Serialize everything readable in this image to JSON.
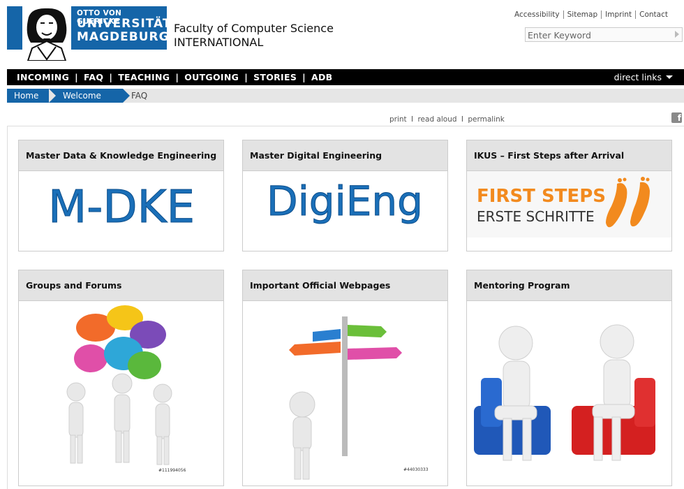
{
  "logo": {
    "line1": "OTTO VON GUERICKE",
    "line2": "UNIVERSITÄT",
    "line3": "MAGDEBURG"
  },
  "faculty": {
    "line1": "Faculty of Computer Science",
    "line2": "INTERNATIONAL"
  },
  "toplinks": [
    "Accessibility",
    "Sitemap",
    "Imprint",
    "Contact"
  ],
  "search": {
    "placeholder": "Enter Keyword"
  },
  "nav": {
    "items": [
      "INCOMING",
      "FAQ",
      "TEACHING",
      "OUTGOING",
      "STORIES",
      "ADB"
    ],
    "direct": "direct links"
  },
  "breadcrumb": {
    "home": "Home",
    "welcome": "Welcome",
    "current": "FAQ"
  },
  "tools": {
    "print": "print",
    "read": "read aloud",
    "perma": "permalink",
    "sep": "I"
  },
  "cards": [
    {
      "title": "Master Data & Knowledge Engineering",
      "image_text": "M-DKE"
    },
    {
      "title": "Master Digital Engineering",
      "image_text": "DigiEng"
    },
    {
      "title": "IKUS – First Steps after Arrival",
      "image_text_1": "FIRST STEPS",
      "image_text_2": "ERSTE SCHRITTE"
    },
    {
      "title": "Groups and Forums",
      "watermark": "#111994056"
    },
    {
      "title": "Important Official Webpages",
      "watermark": "#44030333"
    },
    {
      "title": "Mentoring Program"
    }
  ],
  "colors": {
    "brand_blue": "#1565a8",
    "nav_bg": "#000000",
    "orange": "#f28a1e"
  }
}
